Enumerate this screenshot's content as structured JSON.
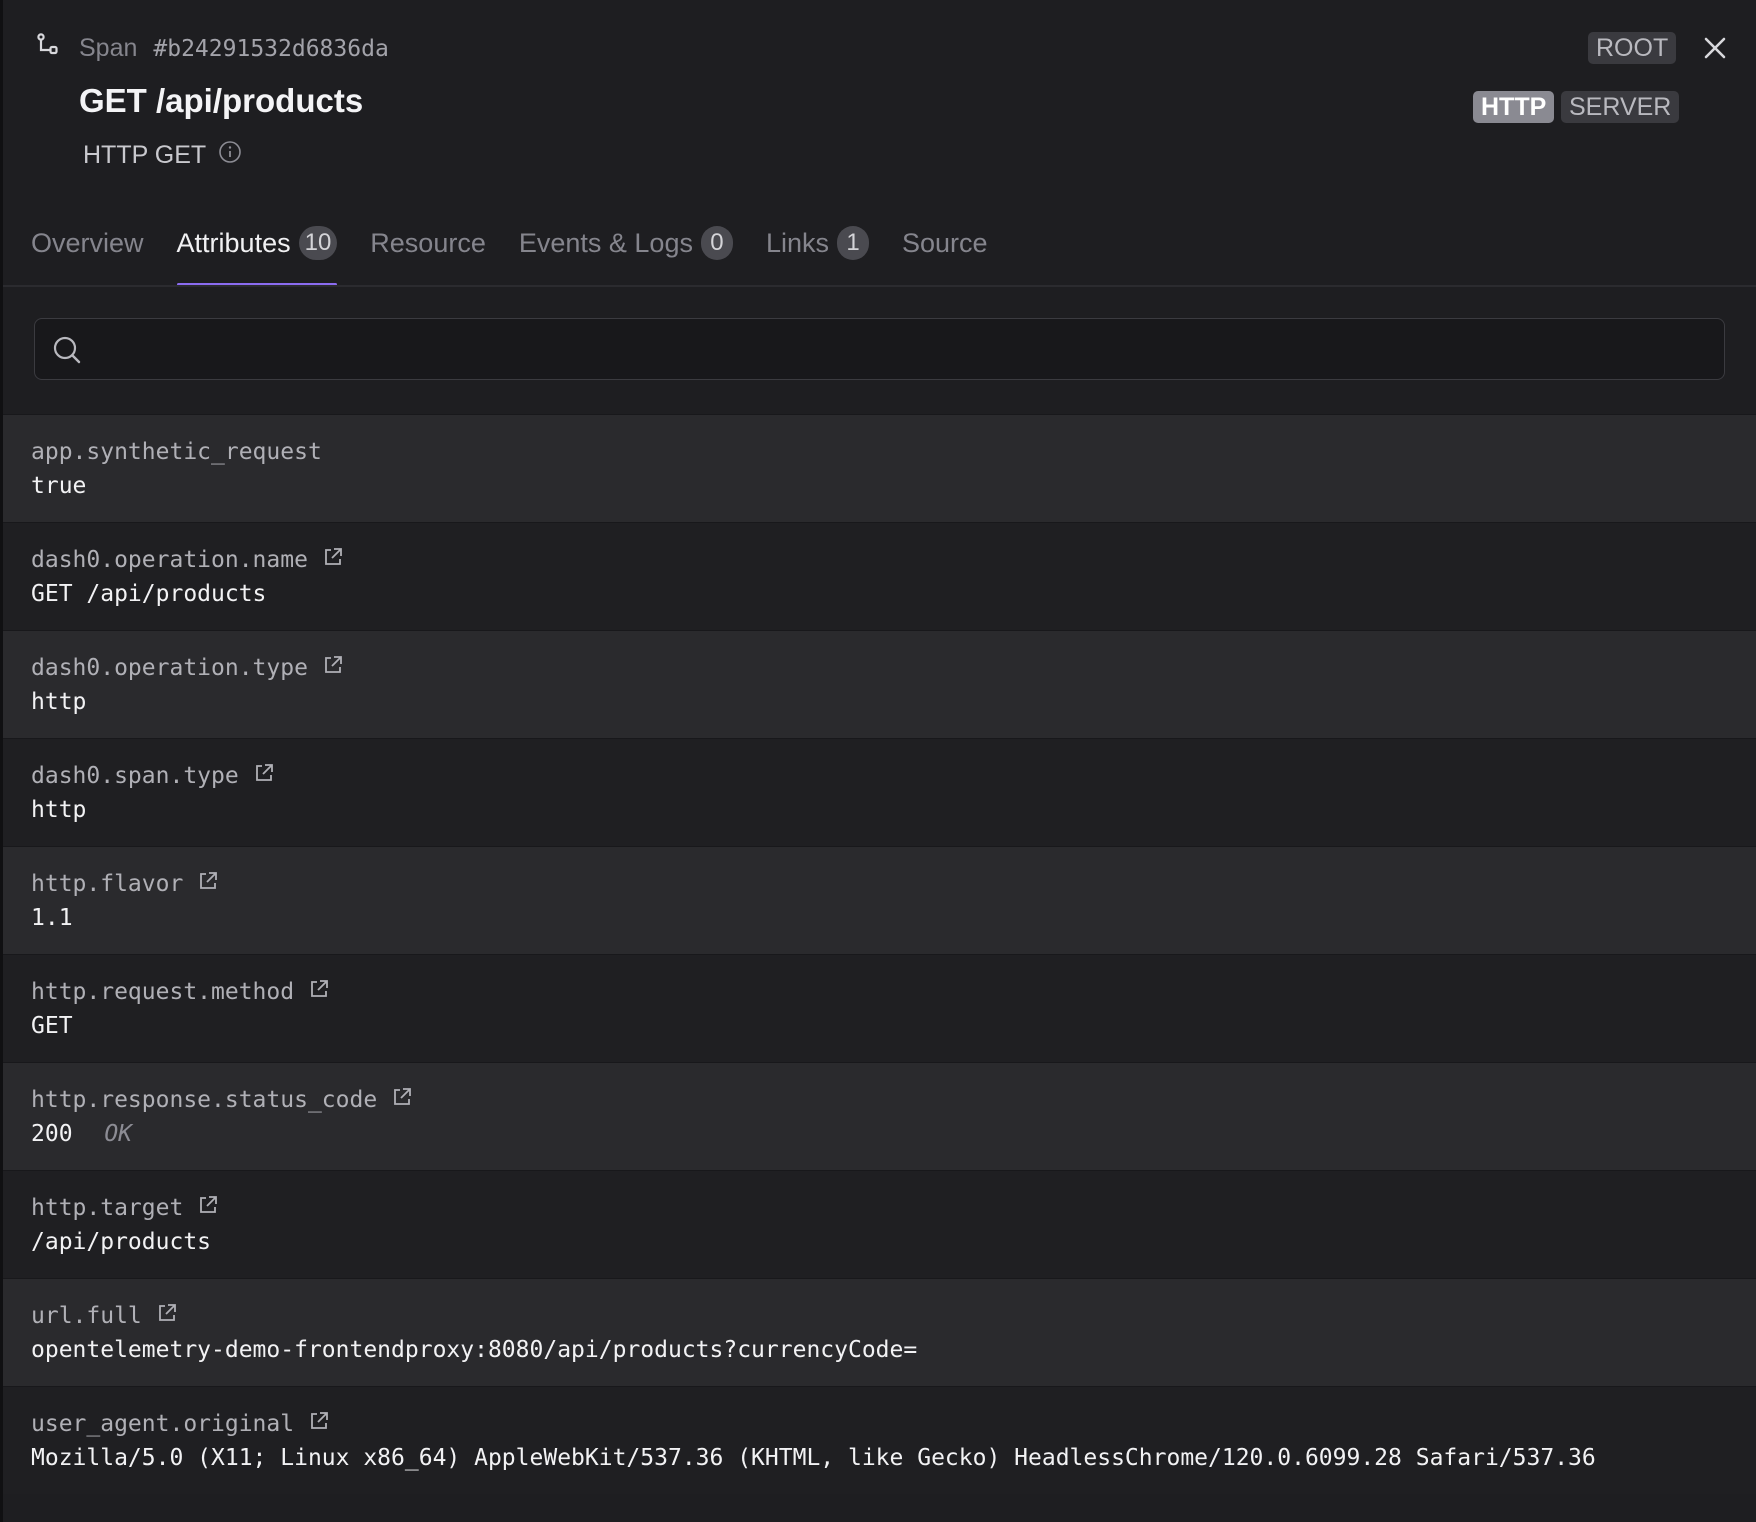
{
  "header": {
    "span_label": "Span",
    "span_id": "#b24291532d6836da",
    "title": "GET /api/products",
    "subtitle": "HTTP GET",
    "root_badge": "ROOT",
    "kind_badges": [
      "HTTP",
      "SERVER"
    ]
  },
  "tabs": [
    {
      "label": "Overview",
      "count": null,
      "active": false
    },
    {
      "label": "Attributes",
      "count": "10",
      "active": true
    },
    {
      "label": "Resource",
      "count": null,
      "active": false
    },
    {
      "label": "Events & Logs",
      "count": "0",
      "active": false
    },
    {
      "label": "Links",
      "count": "1",
      "active": false
    },
    {
      "label": "Source",
      "count": null,
      "active": false
    }
  ],
  "search": {
    "value": "",
    "placeholder": ""
  },
  "attributes": [
    {
      "key": "app.synthetic_request",
      "value": "true",
      "hint": "",
      "link": false
    },
    {
      "key": "dash0.operation.name",
      "value": "GET /api/products",
      "hint": "",
      "link": true
    },
    {
      "key": "dash0.operation.type",
      "value": "http",
      "hint": "",
      "link": true
    },
    {
      "key": "dash0.span.type",
      "value": "http",
      "hint": "",
      "link": true
    },
    {
      "key": "http.flavor",
      "value": "1.1",
      "hint": "",
      "link": true
    },
    {
      "key": "http.request.method",
      "value": "GET",
      "hint": "",
      "link": true
    },
    {
      "key": "http.response.status_code",
      "value": "200",
      "hint": "OK",
      "link": true
    },
    {
      "key": "http.target",
      "value": "/api/products",
      "hint": "",
      "link": true
    },
    {
      "key": "url.full",
      "value": "opentelemetry-demo-frontendproxy:8080/api/products?currencyCode=",
      "hint": "",
      "link": true
    },
    {
      "key": "user_agent.original",
      "value": "Mozilla/5.0 (X11; Linux x86_64) AppleWebKit/537.36 (KHTML, like Gecko) HeadlessChrome/120.0.6099.28 Safari/537.36",
      "hint": "",
      "link": true
    }
  ],
  "colors": {
    "accent": "#8b6cf0",
    "background": "#1e1e21"
  },
  "icons": {
    "span": "span-tree-icon",
    "info": "info-icon",
    "close": "close-icon",
    "search": "search-icon",
    "external": "external-link-icon"
  }
}
